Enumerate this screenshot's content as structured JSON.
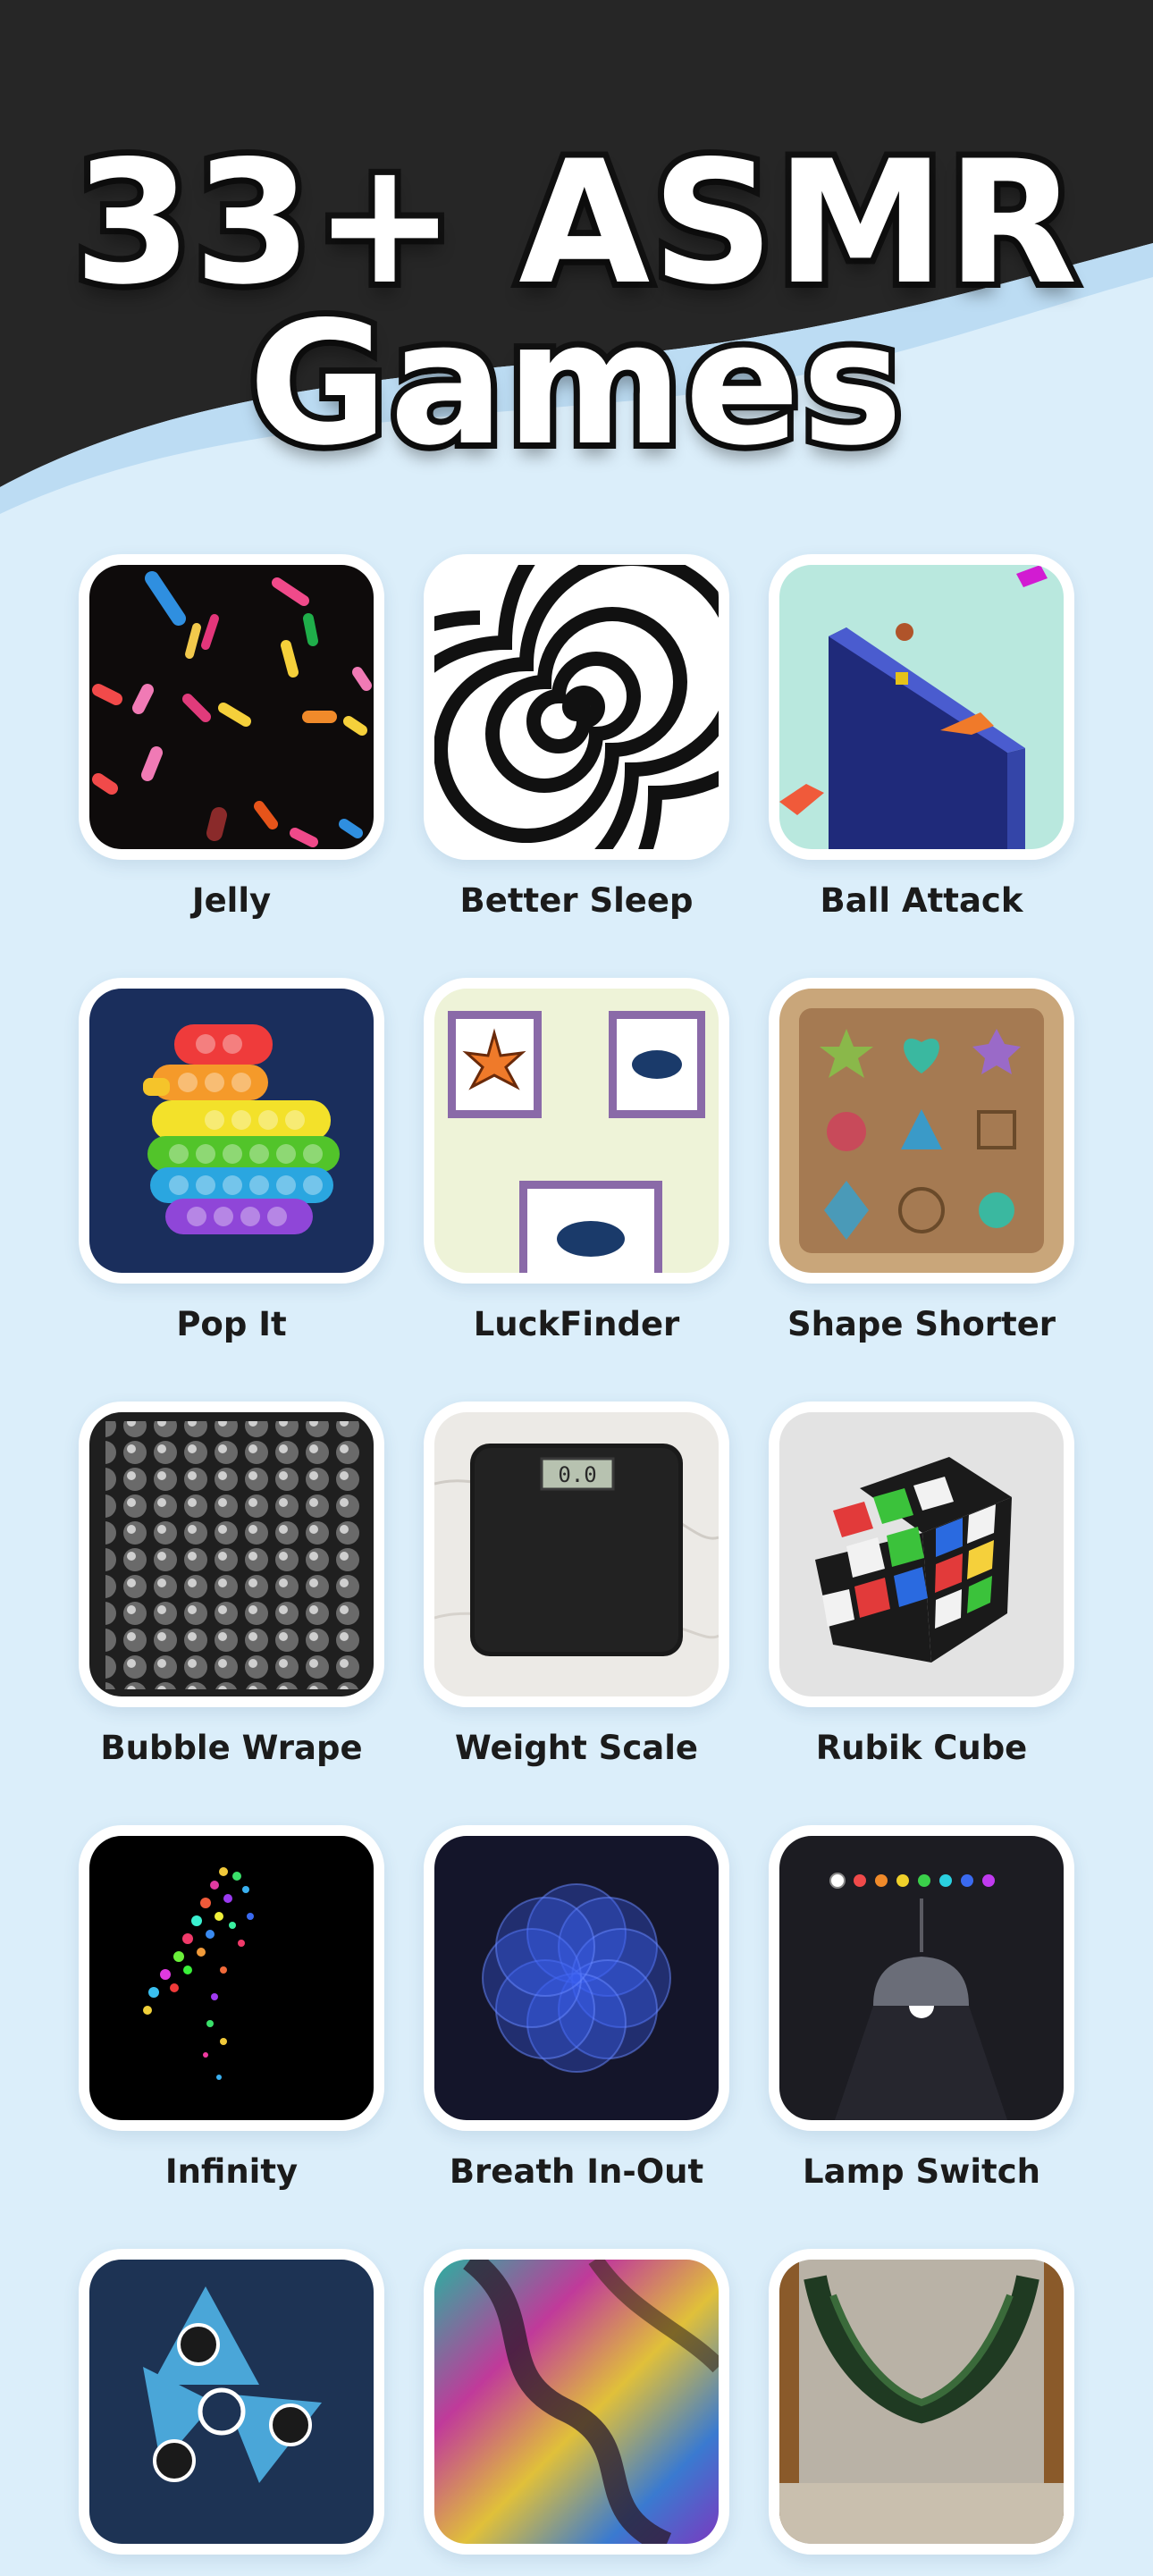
{
  "headline": {
    "line1": "33+ ASMR",
    "line2": "Games"
  },
  "colors": {
    "header": "#262626",
    "background": "#dbeefa",
    "card": "#ffffff",
    "label": "#1b1b1b"
  },
  "games": [
    {
      "label": "Jelly",
      "icon": "jelly-icon"
    },
    {
      "label": "Better Sleep",
      "icon": "spiral-icon"
    },
    {
      "label": "Ball Attack",
      "icon": "ball-attack-icon"
    },
    {
      "label": "Pop It",
      "icon": "pop-it-duck-icon"
    },
    {
      "label": "LuckFinder",
      "icon": "luck-finder-icon"
    },
    {
      "label": "Shape Shorter",
      "icon": "shape-sorter-icon"
    },
    {
      "label": "Bubble Wrape",
      "icon": "bubble-wrap-icon"
    },
    {
      "label": "Weight Scale",
      "icon": "weight-scale-icon",
      "scale_readout": "0.0"
    },
    {
      "label": "Rubik Cube",
      "icon": "rubik-cube-icon"
    },
    {
      "label": "Infinity",
      "icon": "infinity-particles-icon"
    },
    {
      "label": "Breath In-Out",
      "icon": "breath-flower-icon"
    },
    {
      "label": "Lamp Switch",
      "icon": "lamp-icon"
    },
    {
      "label": "",
      "icon": "fidget-spinner-icon"
    },
    {
      "label": "",
      "icon": "colorful-terrain-icon"
    },
    {
      "label": "",
      "icon": "slingshot-forest-icon"
    }
  ]
}
